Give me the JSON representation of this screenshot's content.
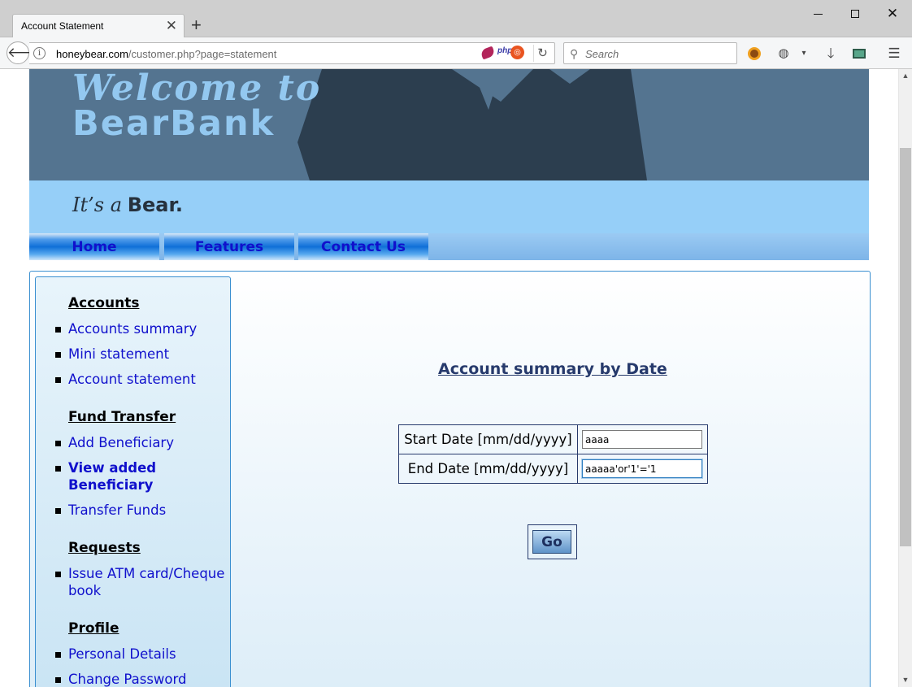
{
  "browser": {
    "tab_title": "Account Statement",
    "url_host": "honeybear.com",
    "url_path": "/customer.php?page=statement",
    "search_placeholder": "Search",
    "ext_php_label": "php"
  },
  "banner": {
    "welcome_line1": "Welcome to",
    "welcome_line2": "BearBank",
    "tagline_italic": "It’s a",
    "tagline_bold": "Bear."
  },
  "nav": {
    "home": "Home",
    "features": "Features",
    "contact": "Contact Us"
  },
  "sidebar": {
    "accounts_heading": "Accounts",
    "accounts_summary": "Accounts summary",
    "mini_statement": "Mini statement",
    "account_statement": "Account statement",
    "fund_transfer_heading": "Fund Transfer",
    "add_beneficiary": "Add Beneficiary",
    "view_added_beneficiary": "View added Beneficiary",
    "transfer_funds": "Transfer Funds",
    "requests_heading": "Requests",
    "issue_card": "Issue ATM card/Cheque book",
    "profile_heading": "Profile",
    "personal_details": "Personal Details",
    "change_password": "Change Password"
  },
  "main": {
    "title": "Account summary by Date",
    "start_label": "Start Date [mm/dd/yyyy]",
    "start_value": "aaaa",
    "end_label": "End Date [mm/dd/yyyy]",
    "end_value": "aaaaa'or'1'='1",
    "go_label": "Go"
  },
  "colors": {
    "banner_dark": "#547490",
    "banner_light": "#96cff8",
    "link_blue": "#1010cc",
    "title_navy": "#273a6c"
  }
}
